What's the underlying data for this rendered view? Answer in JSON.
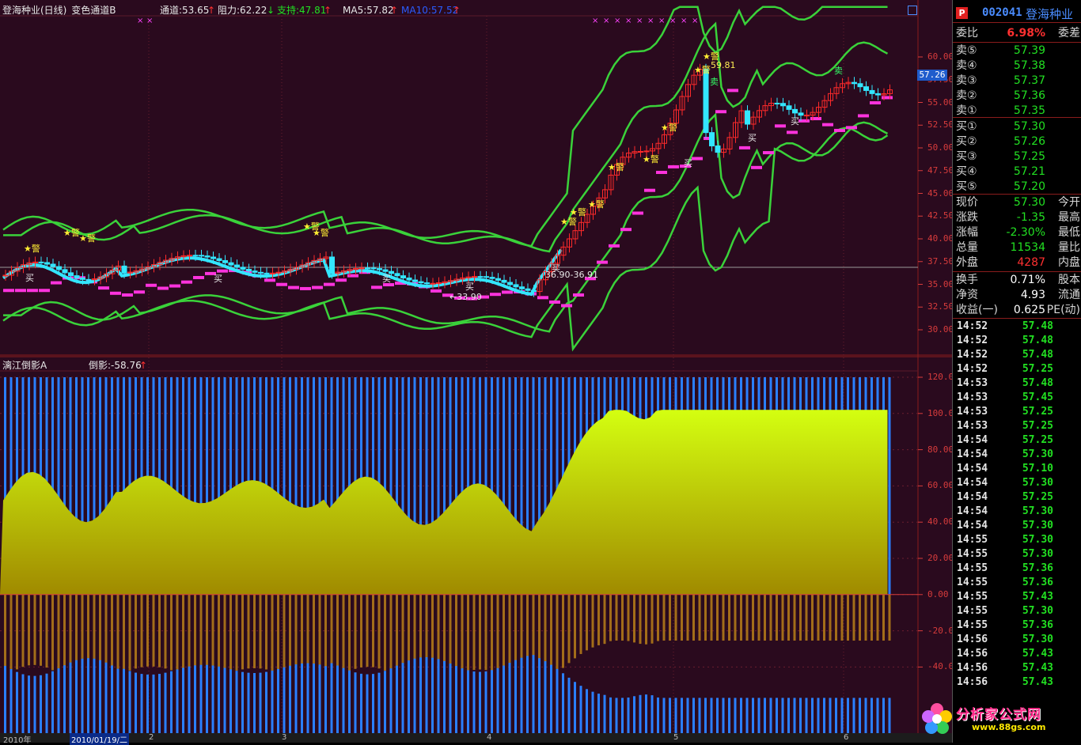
{
  "main_chart": {
    "stock_name": "登海种业(日线)",
    "indicator_name": "变色通道B",
    "channel": "通道:53.65",
    "resistance": "阻力:62.22",
    "support": "支持:47.81",
    "ma5": "MA5:57.82",
    "ma10": "MA10:57.52",
    "price_tag": "57.26",
    "annotations": {
      "peak": "59.81",
      "range": "36.90-36.91",
      "low": "33.90",
      "warn": "警",
      "buy": "买",
      "sell": "卖"
    },
    "y_axis": [
      "60.00",
      "57.50",
      "55.00",
      "52.50",
      "50.00",
      "47.50",
      "45.00",
      "42.50",
      "40.00",
      "37.50",
      "35.00",
      "32.50",
      "30.00"
    ]
  },
  "sub_chart": {
    "indicator_name": "漓江倒影A",
    "value": "倒影:-58.76",
    "y_axis": [
      "120.0",
      "100.0",
      "80.00",
      "60.00",
      "40.00",
      "20.00",
      "0.00",
      "-20.00",
      "-40.00"
    ]
  },
  "bottom_bar": {
    "year": "2010年",
    "date": "2010/01/19/二",
    "months": [
      "2",
      "3",
      "4",
      "5",
      "6"
    ]
  },
  "quote_panel": {
    "code": "002041",
    "name": "登海种业",
    "commission_ratio": {
      "label": "委比",
      "value": "6.98%",
      "right": "委差"
    },
    "asks": [
      {
        "label": "卖⑤",
        "price": "57.39"
      },
      {
        "label": "卖④",
        "price": "57.38"
      },
      {
        "label": "卖③",
        "price": "57.37"
      },
      {
        "label": "卖②",
        "price": "57.36"
      },
      {
        "label": "卖①",
        "price": "57.35"
      }
    ],
    "bids": [
      {
        "label": "买①",
        "price": "57.30"
      },
      {
        "label": "买②",
        "price": "57.26"
      },
      {
        "label": "买③",
        "price": "57.25"
      },
      {
        "label": "买④",
        "price": "57.21"
      },
      {
        "label": "买⑤",
        "price": "57.20"
      }
    ],
    "stats": [
      {
        "label": "现价",
        "value": "57.30",
        "right": "今开",
        "color": "grn"
      },
      {
        "label": "涨跌",
        "value": "-1.35",
        "right": "最高",
        "color": "grn"
      },
      {
        "label": "涨幅",
        "value": "-2.30%",
        "right": "最低",
        "color": "grn"
      },
      {
        "label": "总量",
        "value": "11534",
        "right": "量比",
        "color": "grn"
      },
      {
        "label": "外盘",
        "value": "4287",
        "right": "内盘",
        "color": "red"
      }
    ],
    "stats2": [
      {
        "label": "换手",
        "value": "0.71%",
        "right": "股本"
      },
      {
        "label": "净资",
        "value": "4.93",
        "right": "流通"
      },
      {
        "label": "收益(一)",
        "value": "0.625",
        "right": "PE(动)"
      }
    ],
    "ticks": [
      {
        "t": "14:52",
        "p": "57.48"
      },
      {
        "t": "14:52",
        "p": "57.48"
      },
      {
        "t": "14:52",
        "p": "57.48"
      },
      {
        "t": "14:52",
        "p": "57.25"
      },
      {
        "t": "14:53",
        "p": "57.48"
      },
      {
        "t": "14:53",
        "p": "57.45"
      },
      {
        "t": "14:53",
        "p": "57.25"
      },
      {
        "t": "14:53",
        "p": "57.25"
      },
      {
        "t": "14:54",
        "p": "57.25"
      },
      {
        "t": "14:54",
        "p": "57.30"
      },
      {
        "t": "14:54",
        "p": "57.10"
      },
      {
        "t": "14:54",
        "p": "57.30"
      },
      {
        "t": "14:54",
        "p": "57.25"
      },
      {
        "t": "14:54",
        "p": "57.30"
      },
      {
        "t": "14:54",
        "p": "57.30"
      },
      {
        "t": "14:55",
        "p": "57.30"
      },
      {
        "t": "14:55",
        "p": "57.30"
      },
      {
        "t": "14:55",
        "p": "57.36"
      },
      {
        "t": "14:55",
        "p": "57.36"
      },
      {
        "t": "14:55",
        "p": "57.43"
      },
      {
        "t": "14:55",
        "p": "57.30"
      },
      {
        "t": "14:55",
        "p": "57.36"
      },
      {
        "t": "14:56",
        "p": "57.30"
      },
      {
        "t": "14:56",
        "p": "57.43"
      },
      {
        "t": "14:56",
        "p": "57.43"
      },
      {
        "t": "14:56",
        "p": "57.43"
      }
    ]
  },
  "watermark": {
    "text": "分析家公式网",
    "url": "www.88gs.com"
  },
  "colors": {
    "bg": "#2a0a1e",
    "band": "#3ad23a",
    "support": "#ff33dd",
    "sub_bar": "#2a7fff",
    "fill_top": "#d4ff10",
    "fill_bottom": "#a08a00"
  }
}
